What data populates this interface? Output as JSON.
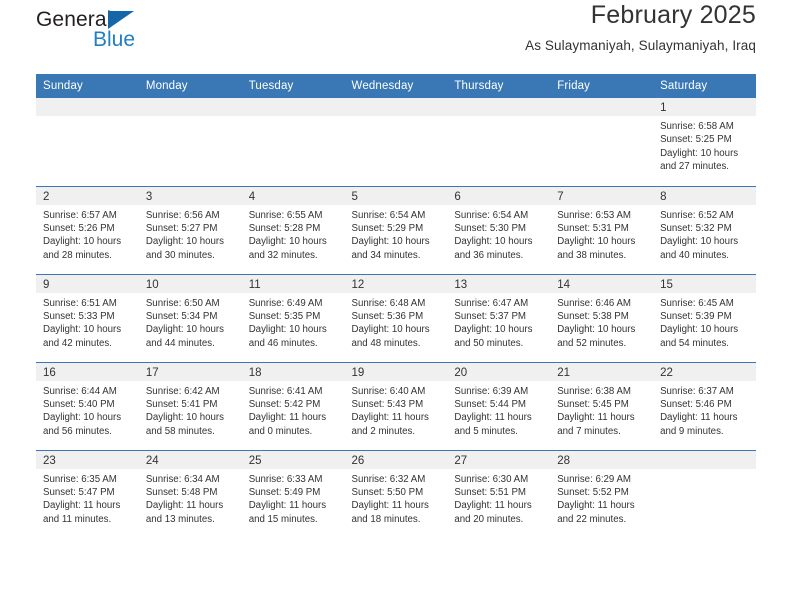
{
  "brand": {
    "name_part1": "General",
    "name_part2": "Blue",
    "accent_color": "#1f7fc4",
    "triangle_color": "#1565a9"
  },
  "header": {
    "title": "February 2025",
    "subtitle": "As Sulaymaniyah, Sulaymaniyah, Iraq"
  },
  "calendar": {
    "header_bg": "#3978b5",
    "daynum_bg": "#f0f0f0",
    "weekday_headers": [
      "Sunday",
      "Monday",
      "Tuesday",
      "Wednesday",
      "Thursday",
      "Friday",
      "Saturday"
    ],
    "weeks": [
      [
        {
          "day": "",
          "sunrise": "",
          "sunset": "",
          "daylight_line1": "",
          "daylight_line2": ""
        },
        {
          "day": "",
          "sunrise": "",
          "sunset": "",
          "daylight_line1": "",
          "daylight_line2": ""
        },
        {
          "day": "",
          "sunrise": "",
          "sunset": "",
          "daylight_line1": "",
          "daylight_line2": ""
        },
        {
          "day": "",
          "sunrise": "",
          "sunset": "",
          "daylight_line1": "",
          "daylight_line2": ""
        },
        {
          "day": "",
          "sunrise": "",
          "sunset": "",
          "daylight_line1": "",
          "daylight_line2": ""
        },
        {
          "day": "",
          "sunrise": "",
          "sunset": "",
          "daylight_line1": "",
          "daylight_line2": ""
        },
        {
          "day": "1",
          "sunrise": "Sunrise: 6:58 AM",
          "sunset": "Sunset: 5:25 PM",
          "daylight_line1": "Daylight: 10 hours",
          "daylight_line2": "and 27 minutes."
        }
      ],
      [
        {
          "day": "2",
          "sunrise": "Sunrise: 6:57 AM",
          "sunset": "Sunset: 5:26 PM",
          "daylight_line1": "Daylight: 10 hours",
          "daylight_line2": "and 28 minutes."
        },
        {
          "day": "3",
          "sunrise": "Sunrise: 6:56 AM",
          "sunset": "Sunset: 5:27 PM",
          "daylight_line1": "Daylight: 10 hours",
          "daylight_line2": "and 30 minutes."
        },
        {
          "day": "4",
          "sunrise": "Sunrise: 6:55 AM",
          "sunset": "Sunset: 5:28 PM",
          "daylight_line1": "Daylight: 10 hours",
          "daylight_line2": "and 32 minutes."
        },
        {
          "day": "5",
          "sunrise": "Sunrise: 6:54 AM",
          "sunset": "Sunset: 5:29 PM",
          "daylight_line1": "Daylight: 10 hours",
          "daylight_line2": "and 34 minutes."
        },
        {
          "day": "6",
          "sunrise": "Sunrise: 6:54 AM",
          "sunset": "Sunset: 5:30 PM",
          "daylight_line1": "Daylight: 10 hours",
          "daylight_line2": "and 36 minutes."
        },
        {
          "day": "7",
          "sunrise": "Sunrise: 6:53 AM",
          "sunset": "Sunset: 5:31 PM",
          "daylight_line1": "Daylight: 10 hours",
          "daylight_line2": "and 38 minutes."
        },
        {
          "day": "8",
          "sunrise": "Sunrise: 6:52 AM",
          "sunset": "Sunset: 5:32 PM",
          "daylight_line1": "Daylight: 10 hours",
          "daylight_line2": "and 40 minutes."
        }
      ],
      [
        {
          "day": "9",
          "sunrise": "Sunrise: 6:51 AM",
          "sunset": "Sunset: 5:33 PM",
          "daylight_line1": "Daylight: 10 hours",
          "daylight_line2": "and 42 minutes."
        },
        {
          "day": "10",
          "sunrise": "Sunrise: 6:50 AM",
          "sunset": "Sunset: 5:34 PM",
          "daylight_line1": "Daylight: 10 hours",
          "daylight_line2": "and 44 minutes."
        },
        {
          "day": "11",
          "sunrise": "Sunrise: 6:49 AM",
          "sunset": "Sunset: 5:35 PM",
          "daylight_line1": "Daylight: 10 hours",
          "daylight_line2": "and 46 minutes."
        },
        {
          "day": "12",
          "sunrise": "Sunrise: 6:48 AM",
          "sunset": "Sunset: 5:36 PM",
          "daylight_line1": "Daylight: 10 hours",
          "daylight_line2": "and 48 minutes."
        },
        {
          "day": "13",
          "sunrise": "Sunrise: 6:47 AM",
          "sunset": "Sunset: 5:37 PM",
          "daylight_line1": "Daylight: 10 hours",
          "daylight_line2": "and 50 minutes."
        },
        {
          "day": "14",
          "sunrise": "Sunrise: 6:46 AM",
          "sunset": "Sunset: 5:38 PM",
          "daylight_line1": "Daylight: 10 hours",
          "daylight_line2": "and 52 minutes."
        },
        {
          "day": "15",
          "sunrise": "Sunrise: 6:45 AM",
          "sunset": "Sunset: 5:39 PM",
          "daylight_line1": "Daylight: 10 hours",
          "daylight_line2": "and 54 minutes."
        }
      ],
      [
        {
          "day": "16",
          "sunrise": "Sunrise: 6:44 AM",
          "sunset": "Sunset: 5:40 PM",
          "daylight_line1": "Daylight: 10 hours",
          "daylight_line2": "and 56 minutes."
        },
        {
          "day": "17",
          "sunrise": "Sunrise: 6:42 AM",
          "sunset": "Sunset: 5:41 PM",
          "daylight_line1": "Daylight: 10 hours",
          "daylight_line2": "and 58 minutes."
        },
        {
          "day": "18",
          "sunrise": "Sunrise: 6:41 AM",
          "sunset": "Sunset: 5:42 PM",
          "daylight_line1": "Daylight: 11 hours",
          "daylight_line2": "and 0 minutes."
        },
        {
          "day": "19",
          "sunrise": "Sunrise: 6:40 AM",
          "sunset": "Sunset: 5:43 PM",
          "daylight_line1": "Daylight: 11 hours",
          "daylight_line2": "and 2 minutes."
        },
        {
          "day": "20",
          "sunrise": "Sunrise: 6:39 AM",
          "sunset": "Sunset: 5:44 PM",
          "daylight_line1": "Daylight: 11 hours",
          "daylight_line2": "and 5 minutes."
        },
        {
          "day": "21",
          "sunrise": "Sunrise: 6:38 AM",
          "sunset": "Sunset: 5:45 PM",
          "daylight_line1": "Daylight: 11 hours",
          "daylight_line2": "and 7 minutes."
        },
        {
          "day": "22",
          "sunrise": "Sunrise: 6:37 AM",
          "sunset": "Sunset: 5:46 PM",
          "daylight_line1": "Daylight: 11 hours",
          "daylight_line2": "and 9 minutes."
        }
      ],
      [
        {
          "day": "23",
          "sunrise": "Sunrise: 6:35 AM",
          "sunset": "Sunset: 5:47 PM",
          "daylight_line1": "Daylight: 11 hours",
          "daylight_line2": "and 11 minutes."
        },
        {
          "day": "24",
          "sunrise": "Sunrise: 6:34 AM",
          "sunset": "Sunset: 5:48 PM",
          "daylight_line1": "Daylight: 11 hours",
          "daylight_line2": "and 13 minutes."
        },
        {
          "day": "25",
          "sunrise": "Sunrise: 6:33 AM",
          "sunset": "Sunset: 5:49 PM",
          "daylight_line1": "Daylight: 11 hours",
          "daylight_line2": "and 15 minutes."
        },
        {
          "day": "26",
          "sunrise": "Sunrise: 6:32 AM",
          "sunset": "Sunset: 5:50 PM",
          "daylight_line1": "Daylight: 11 hours",
          "daylight_line2": "and 18 minutes."
        },
        {
          "day": "27",
          "sunrise": "Sunrise: 6:30 AM",
          "sunset": "Sunset: 5:51 PM",
          "daylight_line1": "Daylight: 11 hours",
          "daylight_line2": "and 20 minutes."
        },
        {
          "day": "28",
          "sunrise": "Sunrise: 6:29 AM",
          "sunset": "Sunset: 5:52 PM",
          "daylight_line1": "Daylight: 11 hours",
          "daylight_line2": "and 22 minutes."
        },
        {
          "day": "",
          "sunrise": "",
          "sunset": "",
          "daylight_line1": "",
          "daylight_line2": ""
        }
      ]
    ]
  }
}
